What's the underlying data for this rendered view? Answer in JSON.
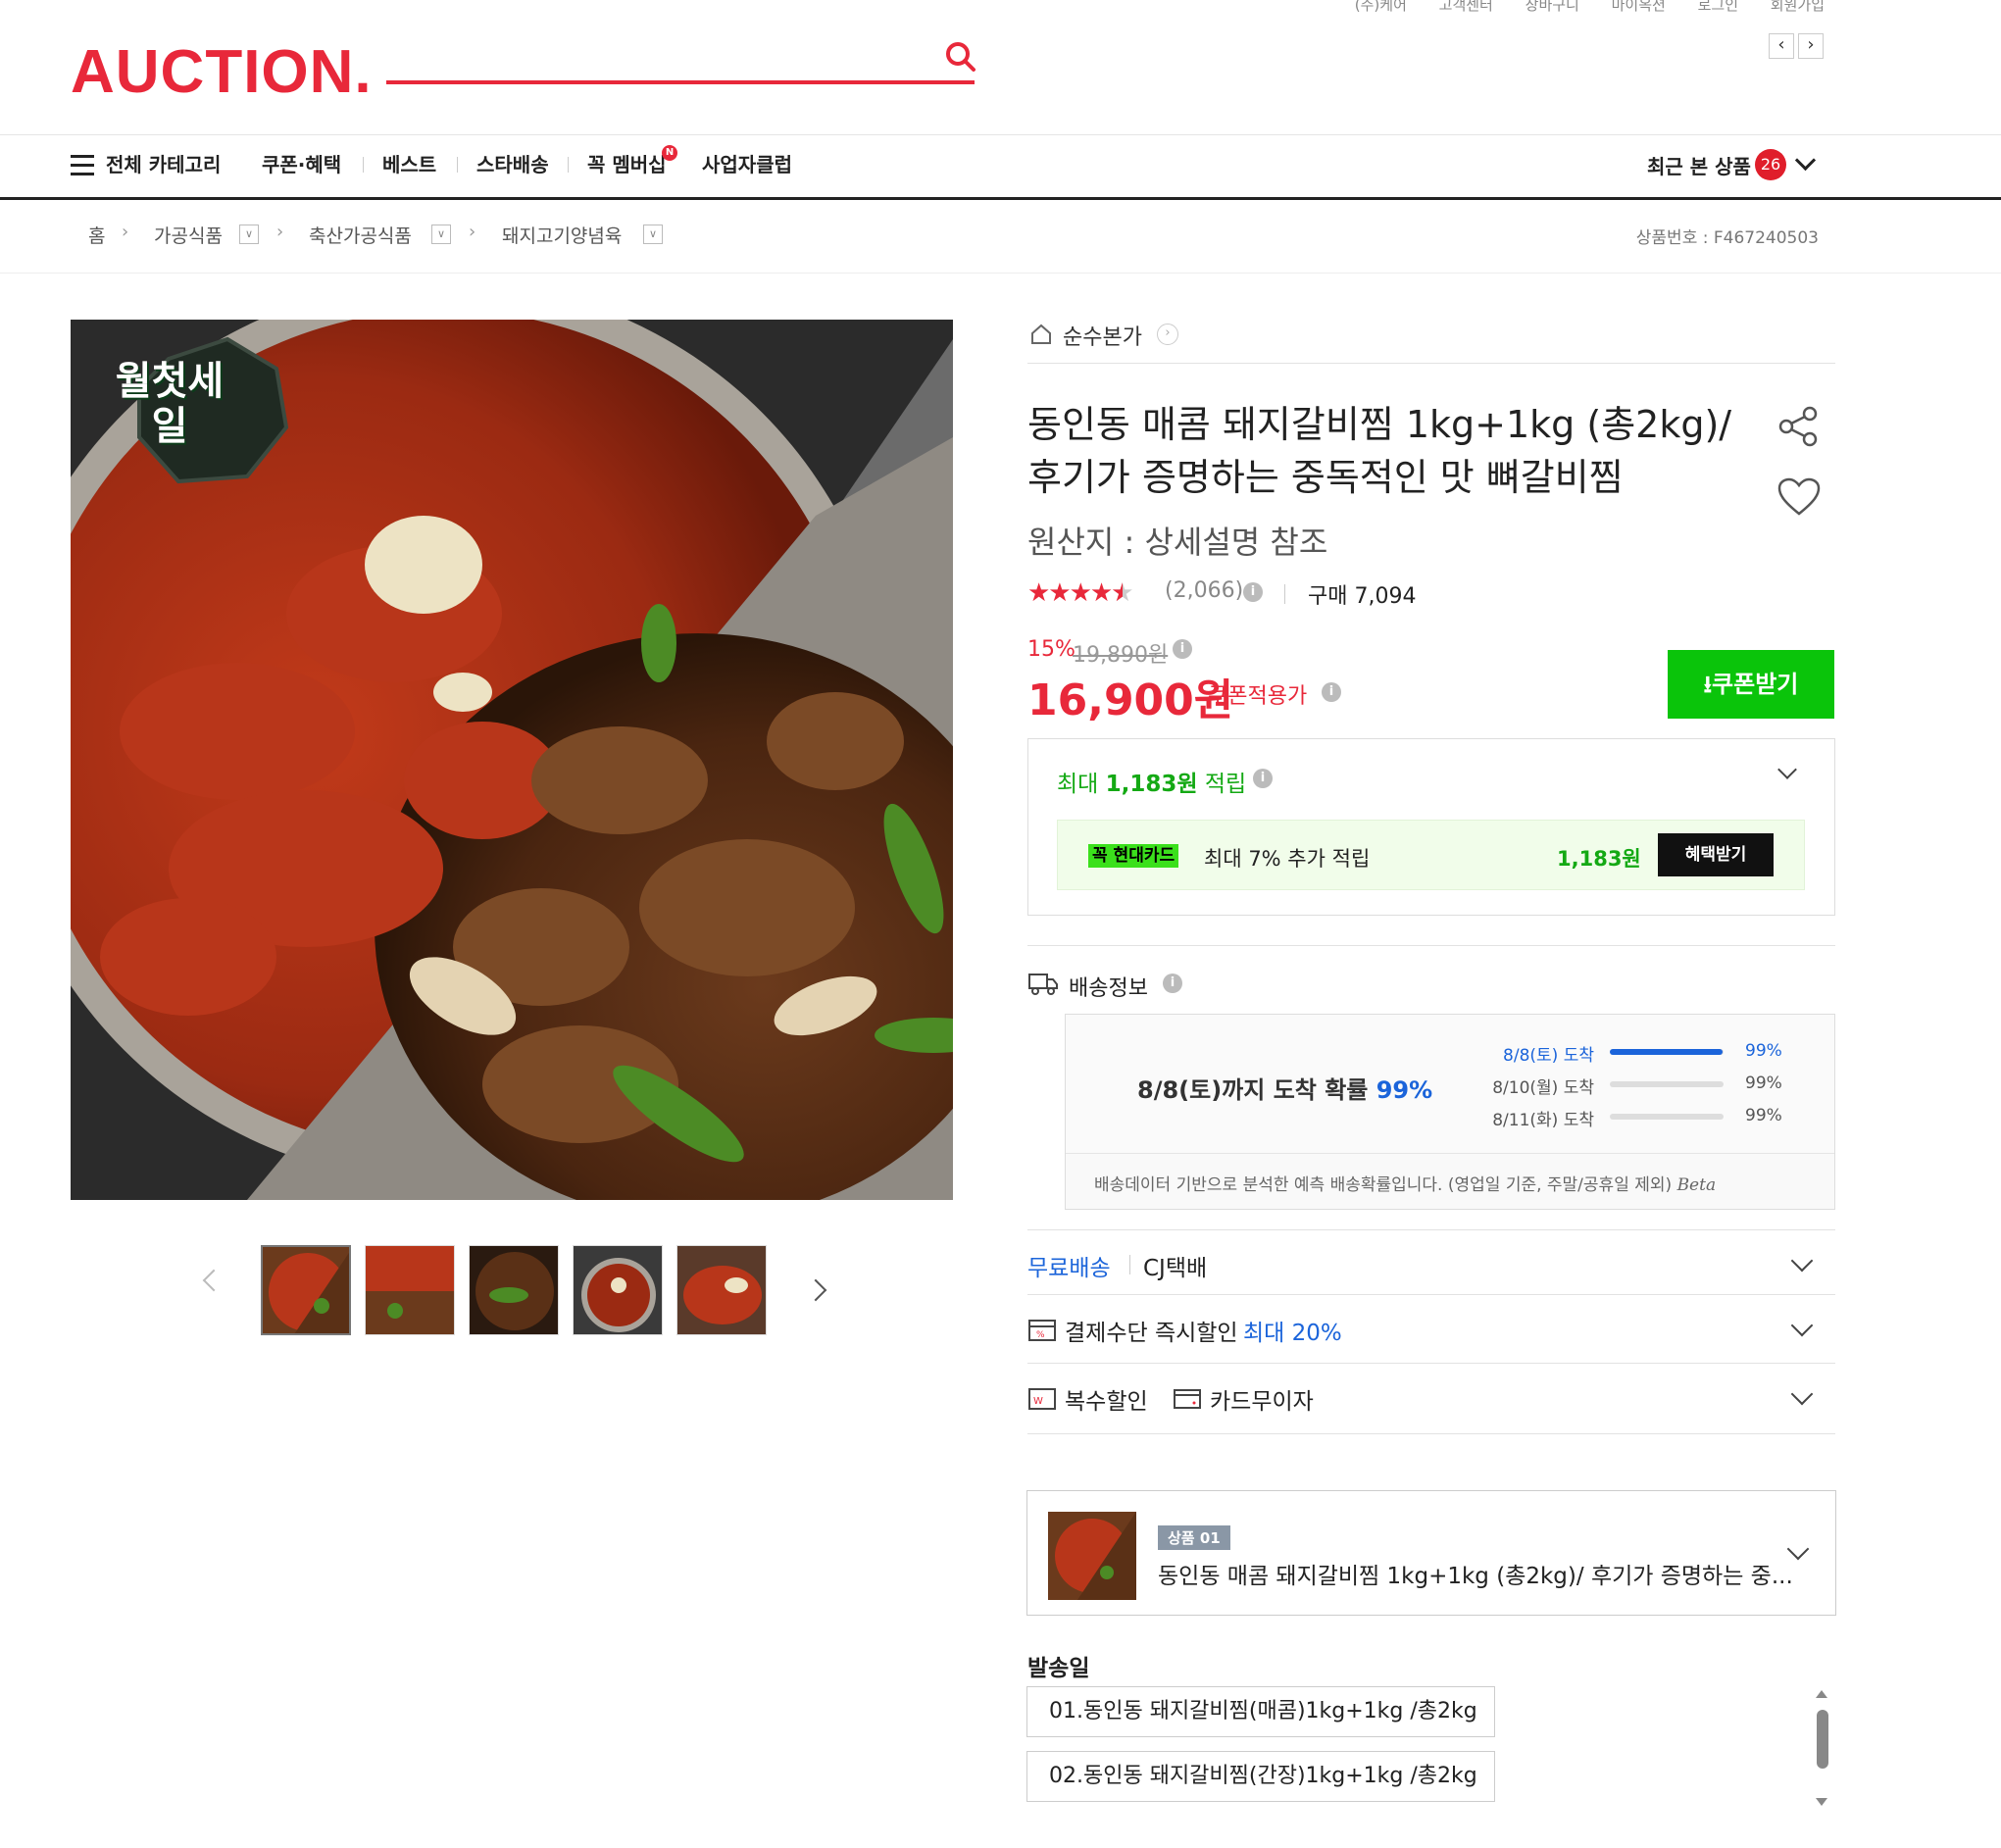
{
  "util_links": [
    "(주)케어",
    "고객센터",
    "장바구니",
    "마이옥션",
    "로그인",
    "회원가입"
  ],
  "logo": "AUCTION.",
  "search": {
    "placeholder": ""
  },
  "nav": {
    "all_categories": "전체 카테고리",
    "items": [
      "쿠폰·혜택",
      "베스트",
      "스타배송",
      "꼭 멤버십",
      "사업자클럽"
    ],
    "membership_badge": "N",
    "recent_label": "최근 본 상품",
    "recent_count": "26"
  },
  "breadcrumb": [
    "홈",
    "가공식품",
    "축산가공식품",
    "돼지고기양념육"
  ],
  "product_no": "상품번호 : F467240503",
  "store_name": "순수본가",
  "title_line1": "동인동 매콤 돼지갈비찜 1kg+1kg (총2kg)/",
  "title_line2": "후기가 증명하는 중독적인 맛 뼈갈비찜",
  "origin": "원산지 : 상세설명 참조",
  "rating": {
    "stars": 4.5,
    "count": "(2,066)"
  },
  "purchase": "구매 7,094",
  "discount_rate": "15%",
  "original_price": "19,890원",
  "price": "16,900원",
  "price_label": "쿠폰적용가",
  "coupon_button": "쿠폰받기",
  "points": {
    "prefix": "최대",
    "amount": "1,183원",
    "suffix": "적립",
    "card_tag": "꼭 현대카드",
    "card_text": "최대 7% 추가 적립",
    "card_amount": "1,183원",
    "benefit_button": "혜택받기"
  },
  "shipping": {
    "title": "배송정보",
    "headline_prefix": "8/8(토)까지 도착 확률",
    "headline_pct": "99%",
    "rows": [
      {
        "label": "8/8(토) 도착",
        "pct": "99%",
        "fill": 0.99,
        "active": true
      },
      {
        "label": "8/10(월) 도착",
        "pct": "99%",
        "fill": 0.0,
        "active": false
      },
      {
        "label": "8/11(화) 도착",
        "pct": "99%",
        "fill": 0.0,
        "active": false
      }
    ],
    "note": "배송데이터 기반으로 분석한 예측 배송확률입니다. (영업일 기준, 주말/공휴일 제외)",
    "beta": "Beta"
  },
  "free_shipping": "무료배송",
  "courier": "CJ택배",
  "payment_discount": "결제수단 즉시할인",
  "payment_discount_max": "최대 20%",
  "multi_discount": "복수할인",
  "card_interest_free": "카드무이자",
  "option": {
    "tag": "상품 01",
    "name": "동인동 매콤 돼지갈비찜 1kg+1kg (총2kg)/ 후기가 증명하는 중..."
  },
  "ship_date_label": "발송일",
  "select_options": [
    "01.동인동 돼지갈비찜(매콤)1kg+1kg /총2kg",
    "02.동인동 돼지갈비찜(간장)1kg+1kg /총2kg"
  ],
  "image_badge": "월첫세일",
  "colors": {
    "brand_red": "#e8283a",
    "green": "#0ac40a",
    "blue": "#1b64da"
  }
}
